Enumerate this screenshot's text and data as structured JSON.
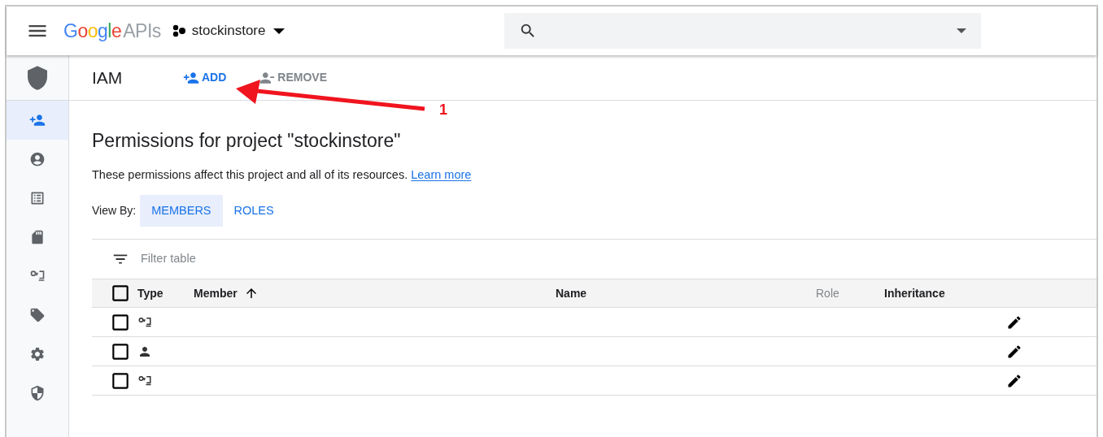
{
  "header": {
    "logo": "Google",
    "logo_suffix": "APIs",
    "project": "stockinstore"
  },
  "sidebar": {
    "items": [
      {
        "kind": "add-person",
        "selected": true
      },
      {
        "kind": "account",
        "selected": false
      },
      {
        "kind": "list",
        "selected": false
      },
      {
        "kind": "storage",
        "selected": false
      },
      {
        "kind": "service-account",
        "selected": false
      },
      {
        "kind": "tag",
        "selected": false
      },
      {
        "kind": "settings",
        "selected": false
      },
      {
        "kind": "shield",
        "selected": false
      }
    ]
  },
  "toolbar": {
    "title": "IAM",
    "actions": [
      {
        "kind": "add",
        "label": "ADD",
        "disabled": false
      },
      {
        "kind": "remove",
        "label": "REMOVE",
        "disabled": true
      }
    ]
  },
  "annotation": {
    "label": "1"
  },
  "page": {
    "heading": "Permissions for project \"stockinstore\"",
    "description": "These permissions affect this project and all of its resources.",
    "link": "Learn more"
  },
  "view_by": {
    "label": "View By:",
    "tabs": [
      {
        "label": "MEMBERS",
        "selected": true
      },
      {
        "label": "ROLES",
        "selected": false
      }
    ]
  },
  "filter": {
    "placeholder": "Filter table"
  },
  "table": {
    "select_all": {
      "checked": false
    },
    "columns": [
      {
        "label": "Type",
        "sorted": false,
        "disabled": false
      },
      {
        "label": "Member",
        "sorted": true,
        "disabled": false
      },
      {
        "label": "Name",
        "sorted": false,
        "disabled": false
      },
      {
        "label": "Role",
        "sorted": false,
        "disabled": true
      },
      {
        "label": "Inheritance",
        "sorted": false,
        "disabled": false
      }
    ],
    "rows": [
      {
        "checked": false,
        "kind": "service-account"
      },
      {
        "checked": false,
        "kind": "person"
      },
      {
        "checked": false,
        "kind": "service-account"
      }
    ]
  }
}
